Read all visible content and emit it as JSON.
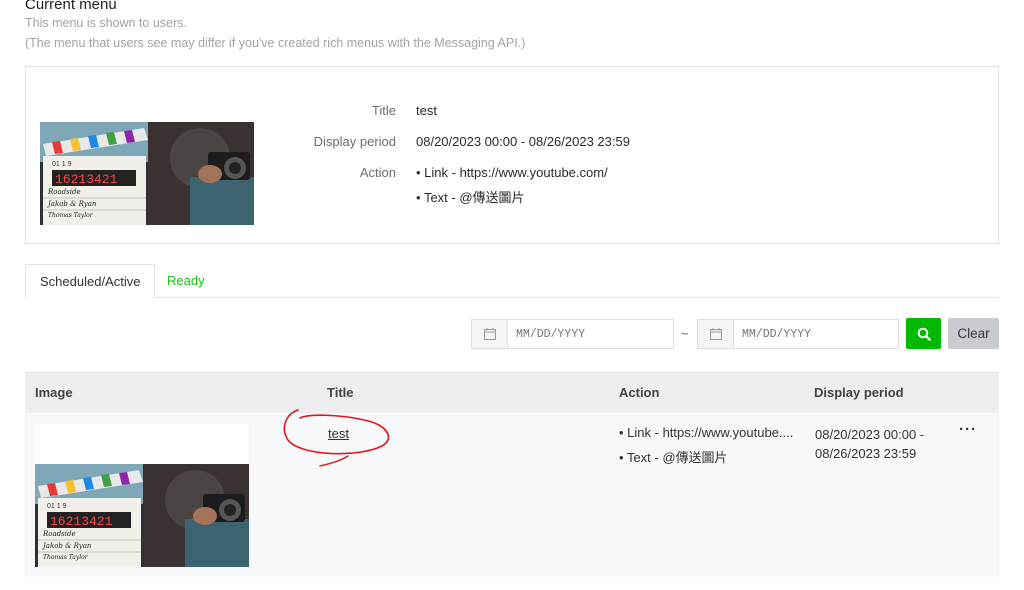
{
  "header": {
    "title": "Current menu",
    "subtitle": "This menu is shown to users.",
    "note": "(The menu that users see may differ if you've created rich menus with the Messaging API.)"
  },
  "current_menu": {
    "title_label": "Title",
    "title_value": "test",
    "period_label": "Display period",
    "period_value": "08/20/2023 00:00 - 08/26/2023 23:59",
    "action_label": "Action",
    "actions": [
      "Link - https://www.youtube.com/",
      "Text - @傳送圖片"
    ],
    "clapper_counter": "16213421",
    "clapper_lines": [
      "Roadside",
      "Jakob & Ryan",
      "Thomas Taylor"
    ]
  },
  "tabs": [
    {
      "label": "Scheduled/Active",
      "active": true
    },
    {
      "label": "Ready",
      "active": false
    }
  ],
  "filter": {
    "start_placeholder": "MM/DD/YYYY",
    "end_placeholder": "MM/DD/YYYY",
    "separator": "~",
    "search_icon": "search-icon",
    "clear_label": "Clear"
  },
  "table": {
    "headers": [
      "Image",
      "Title",
      "Action",
      "Display period"
    ],
    "rows": [
      {
        "title": "test",
        "actions": [
          "Link - https://www.youtube....",
          "Text - @傳送圖片"
        ],
        "period_start": "08/20/2023 00:00 -",
        "period_end": "08/26/2023 23:59",
        "more": "···"
      }
    ]
  },
  "colors": {
    "accent_green": "#00b900",
    "ready_tab": "#1cbd1c",
    "annotation_red": "#e0141e"
  }
}
